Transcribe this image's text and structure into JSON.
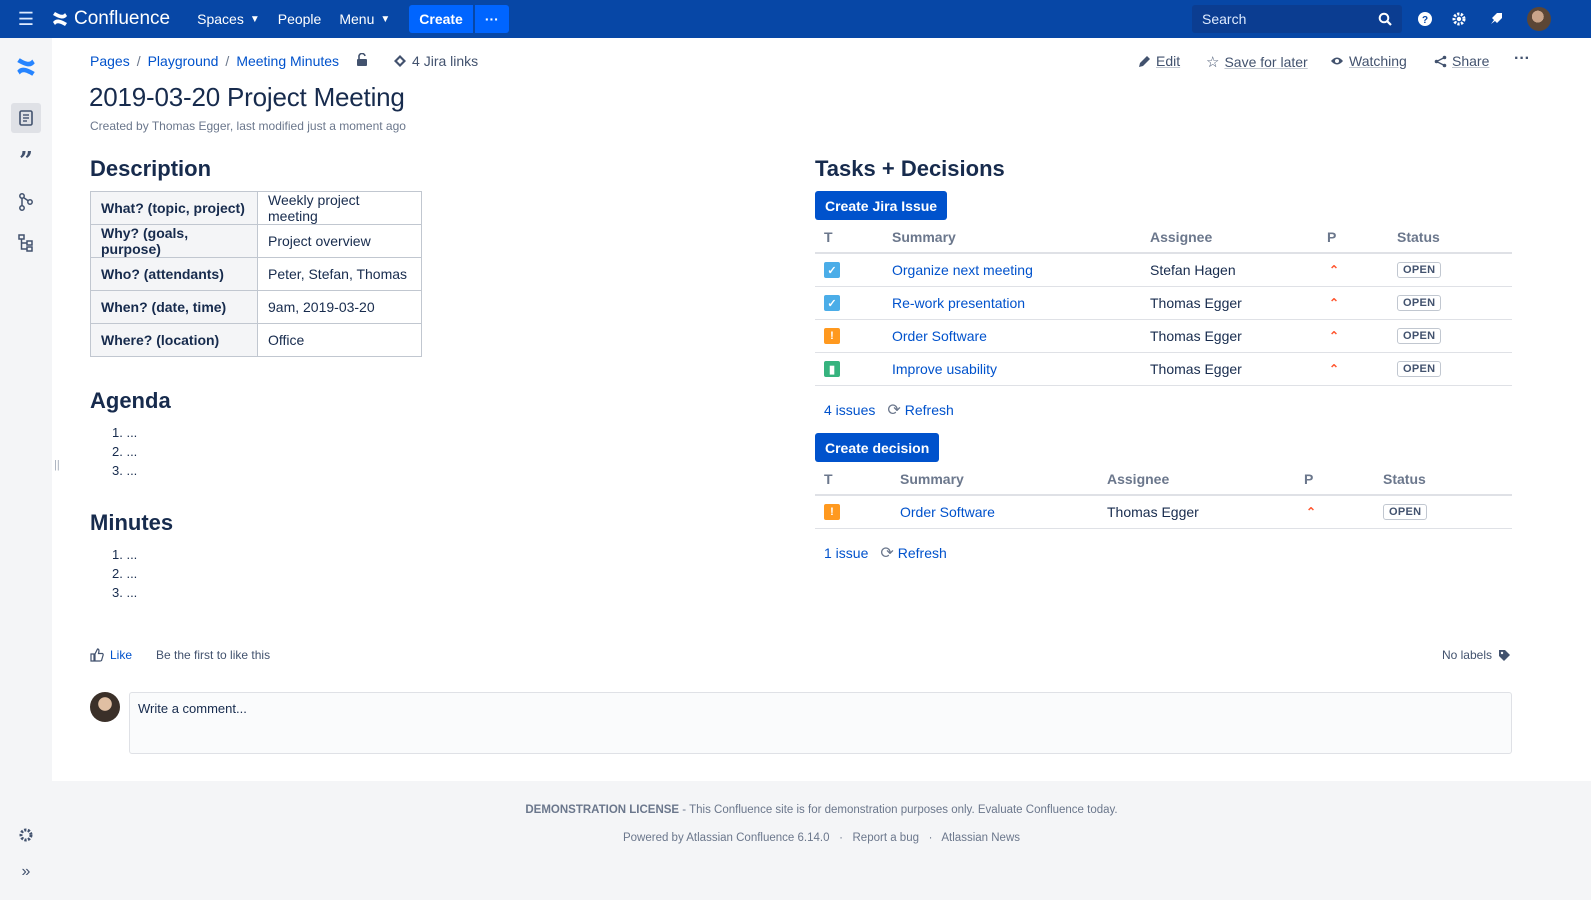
{
  "topnav": {
    "app_name": "Confluence",
    "items": [
      {
        "label": "Spaces",
        "has_dropdown": true
      },
      {
        "label": "People",
        "has_dropdown": false
      },
      {
        "label": "Menu",
        "has_dropdown": true
      }
    ],
    "create_label": "Create",
    "more_label": "···",
    "search_placeholder": "Search",
    "icons": [
      "hamburger-icon",
      "confluence-logo-icon",
      "search-icon",
      "help-icon",
      "settings-icon",
      "notifications-icon",
      "avatar"
    ]
  },
  "sidebar": {
    "icons": [
      "confluence-logo-icon",
      "pages-icon",
      "blog-quote-icon",
      "shortcuts-icon",
      "page-tree-icon",
      "space-settings-icon",
      "expand-sidebar-icon"
    ],
    "active": "pages-icon"
  },
  "breadcrumb": {
    "items": [
      "Pages",
      "Playground",
      "Meeting Minutes"
    ],
    "separator": "/",
    "jira_links": "4 Jira links"
  },
  "page_actions": {
    "edit": "Edit",
    "save_for_later": "Save for later",
    "watching": "Watching",
    "share": "Share",
    "more": "···"
  },
  "page": {
    "title": "2019-03-20 Project Meeting",
    "byline": "Created by Thomas Egger, last modified just a moment ago"
  },
  "description": {
    "heading": "Description",
    "rows": [
      {
        "key": "What? (topic, project)",
        "value": "Weekly project meeting"
      },
      {
        "key": "Why? (goals, purpose)",
        "value": "Project overview"
      },
      {
        "key": "Who? (attendants)",
        "value": "Peter, Stefan, Thomas"
      },
      {
        "key": "When? (date, time)",
        "value": "9am, 2019-03-20"
      },
      {
        "key": "Where? (location)",
        "value": "Office"
      }
    ]
  },
  "agenda": {
    "heading": "Agenda",
    "items": [
      "1. ...",
      "2. ...",
      "3. ..."
    ]
  },
  "minutes": {
    "heading": "Minutes",
    "items": [
      "1. ...",
      "2. ...",
      "3. ..."
    ]
  },
  "tasks": {
    "heading": "Tasks + Decisions",
    "create_issue_label": "Create Jira Issue",
    "columns": [
      "T",
      "Summary",
      "Assignee",
      "P",
      "Status"
    ],
    "rows": [
      {
        "type": "task",
        "type_color": "#4bade8",
        "summary": "Organize next meeting",
        "assignee": "Stefan Hagen",
        "status": "OPEN"
      },
      {
        "type": "task",
        "type_color": "#4bade8",
        "summary": "Re-work presentation",
        "assignee": "Thomas Egger",
        "status": "OPEN"
      },
      {
        "type": "improvement",
        "type_color": "#ff991f",
        "summary": "Order Software",
        "assignee": "Thomas Egger",
        "status": "OPEN"
      },
      {
        "type": "story",
        "type_color": "#36b37e",
        "summary": "Improve usability",
        "assignee": "Thomas Egger",
        "status": "OPEN"
      }
    ],
    "count": "4 issues",
    "refresh": "Refresh"
  },
  "decisions": {
    "create_label": "Create decision",
    "columns": [
      "T",
      "Summary",
      "Assignee",
      "P",
      "Status"
    ],
    "rows": [
      {
        "type": "improvement",
        "type_color": "#ff991f",
        "summary": "Order Software",
        "assignee": "Thomas Egger",
        "status": "OPEN"
      }
    ],
    "count": "1 issue",
    "refresh": "Refresh"
  },
  "likes": {
    "like_label": "Like",
    "first_text": "Be the first to like this",
    "labels_text": "No labels"
  },
  "comment": {
    "placeholder": "Write a comment..."
  },
  "footer": {
    "license_title": "DEMONSTRATION LICENSE",
    "license_text": " - This Confluence site is for demonstration purposes only. Evaluate Confluence today.",
    "powered_by": "Powered by Atlassian Confluence 6.14.0",
    "sep": "·",
    "report_bug": "Report a bug",
    "news": "Atlassian News"
  },
  "colors": {
    "nav_bg": "#0747a6",
    "primary": "#0052cc",
    "priority_high": "#ff5630"
  }
}
